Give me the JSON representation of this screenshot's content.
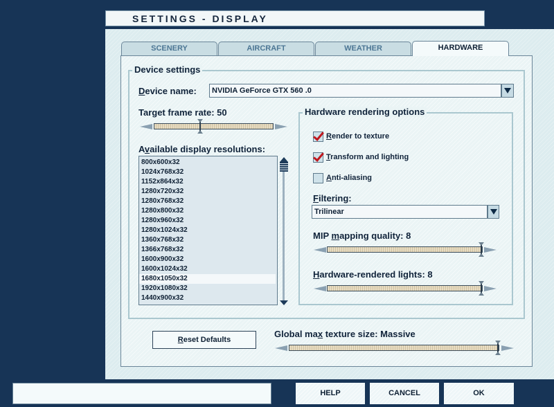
{
  "window": {
    "title": "SETTINGS - DISPLAY"
  },
  "tabs": [
    {
      "label": "SCENERY"
    },
    {
      "label": "AIRCRAFT"
    },
    {
      "label": "WEATHER"
    },
    {
      "label": "HARDWARE",
      "active": true
    }
  ],
  "device_settings": {
    "group_label": "Device settings",
    "device_name": {
      "label": "Device name:",
      "value": "NVIDIA GeForce GTX 560 .0"
    },
    "target_frame_rate": {
      "label": "Target frame rate: 50",
      "value": 50,
      "level_fraction": 0.39
    },
    "resolutions": {
      "label": "Available display resolutions:",
      "items": [
        "800x600x32",
        "1024x768x32",
        "1152x864x32",
        "1280x720x32",
        "1280x768x32",
        "1280x800x32",
        "1280x960x32",
        "1280x1024x32",
        "1360x768x32",
        "1366x768x32",
        "1600x900x32",
        "1600x1024x32",
        "1680x1050x32",
        "1920x1080x32",
        "1440x900x32"
      ],
      "selected": "1680x1050x32"
    },
    "hardware_rendering": {
      "group_label": "Hardware rendering options",
      "checkboxes": [
        {
          "label": "Render to texture",
          "checked": true
        },
        {
          "label": "Transform and lighting",
          "checked": true
        },
        {
          "label": "Anti-aliasing",
          "checked": false
        }
      ],
      "filtering": {
        "label": "Filtering:",
        "value": "Trilinear"
      },
      "mip_mapping": {
        "label": "MIP mapping quality: 8",
        "value": 8,
        "level_fraction": 1.0
      },
      "hw_lights": {
        "label": "Hardware-rendered lights: 8",
        "value": 8,
        "level_fraction": 1.0
      }
    }
  },
  "reset_defaults": {
    "label": "Reset Defaults"
  },
  "global_texture": {
    "label": "Global max texture size: Massive",
    "value": "Massive",
    "level_fraction": 1.0
  },
  "bottom_bar": {
    "status_text": "",
    "help_label": "HELP",
    "cancel_label": "CANCEL",
    "ok_label": "OK"
  }
}
